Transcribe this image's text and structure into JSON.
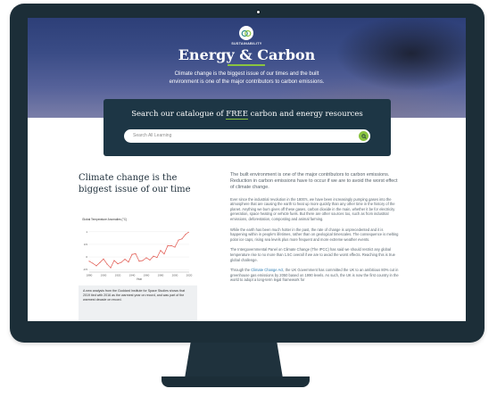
{
  "hero": {
    "kicker": "SUSTAINABILITY",
    "title": "Energy & Carbon",
    "subtitle": "Climate change is the biggest issue of our times and the built environment is one of the major contributors to carbon emissions."
  },
  "search": {
    "heading_before": "Search our catalogue of ",
    "heading_highlight": "FREE",
    "heading_after": " carbon and energy resources",
    "placeholder": "Search All Learning"
  },
  "left": {
    "heading": "Climate change is the biggest issue of our time",
    "caption": "A new analysis from the Goddard Institute for Space Studies shows that 2019 tied with 2016 as the warmest year on record, and was part of the warmest decade on record."
  },
  "right": {
    "intro": "The built environment is one of the major contributors to carbon emissions. Reduction in carbon emissions have to occur if we are to avoid the worst effect of climate change.",
    "p1": "Ever since the industrial revolution in the 1800's, we have been increasingly pumping gases into the atmosphere that are causing the earth to heat up more quickly than any other time in the history of the planet. Anything we burn gives off these gases, carbon dioxide in the main, whether it be for electricity generation, space heating or vehicle fuels. But there are other sources too, such as from industrial emissions, deforestation, composting and animal farming.",
    "p2": "While the earth has been much hotter in the past, the rate of change is unprecedented and it is happening within in people's lifetimes, rather than on geological timescales. The consequence is melting polar ice caps, rising sea levels plus more frequent and more extreme weather events.",
    "p3": "The Intergovernmental Panel on Climate Change (The IPCC) has said we should restrict any global temperature rise to no more than 1.5C overall if we are to avoid the worst effects. Reaching this is true global challenge.",
    "p4_before": "Through the ",
    "p4_link": "Climate Change Act",
    "p4_after": ", the UK Government has committed the UK to an ambitious 80% cut in greenhouse gas emissions by 2050 based on 1990 levels. As such, the UK is now the first country in the world to adopt a long-term legal framework for"
  },
  "chart_data": {
    "type": "line",
    "title": "Global Temperature Anomalies (°C)",
    "xlabel": "Year",
    "ylabel": "",
    "x_ticks": [
      "1880",
      "1900",
      "1920",
      "1940",
      "1960",
      "1980",
      "2000",
      "2020"
    ],
    "y_ticks": [
      "-0.5",
      "0",
      "0.5",
      "1"
    ],
    "xlim": [
      1880,
      2020
    ],
    "ylim": [
      -0.6,
      1.1
    ],
    "series": [
      {
        "color": "#e0534a",
        "x": [
          1880,
          1885,
          1890,
          1895,
          1900,
          1905,
          1910,
          1915,
          1920,
          1925,
          1930,
          1935,
          1940,
          1945,
          1950,
          1955,
          1960,
          1965,
          1970,
          1975,
          1980,
          1985,
          1990,
          1995,
          2000,
          2005,
          2010,
          2015,
          2019
        ],
        "y": [
          -0.17,
          -0.25,
          -0.35,
          -0.22,
          -0.08,
          -0.28,
          -0.43,
          -0.14,
          -0.27,
          -0.21,
          -0.09,
          -0.2,
          0.1,
          0.13,
          -0.17,
          -0.14,
          -0.03,
          -0.12,
          0.03,
          -0.02,
          0.26,
          0.12,
          0.45,
          0.45,
          0.39,
          0.67,
          0.72,
          0.9,
          0.98
        ]
      }
    ]
  }
}
